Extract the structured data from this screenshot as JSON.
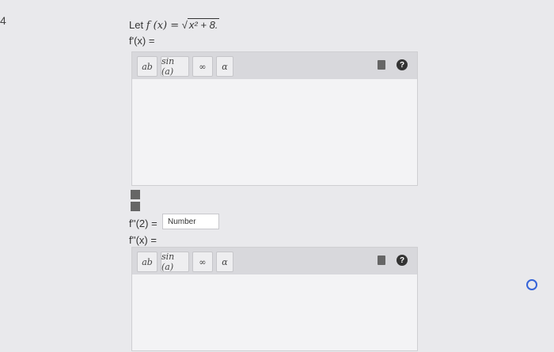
{
  "question_number": "4",
  "problem": {
    "let_text": "Let",
    "function": "f (x) =",
    "radicand": "x² + 8.",
    "derivative1_label": "f'(x) =",
    "f2_label": "f''(2) =",
    "second_derivative_label": "f''(x) ="
  },
  "toolbar": {
    "power_label": "ab",
    "sin_label": "sin (a)",
    "infinity_label": "∞",
    "alpha_label": "α",
    "help_label": "?"
  },
  "field": {
    "placeholder": "Number"
  },
  "colors": {
    "page_bg": "#e9e9ec",
    "toolbar_bg": "#d8d8dc",
    "accent_dot": "#3563d8"
  }
}
